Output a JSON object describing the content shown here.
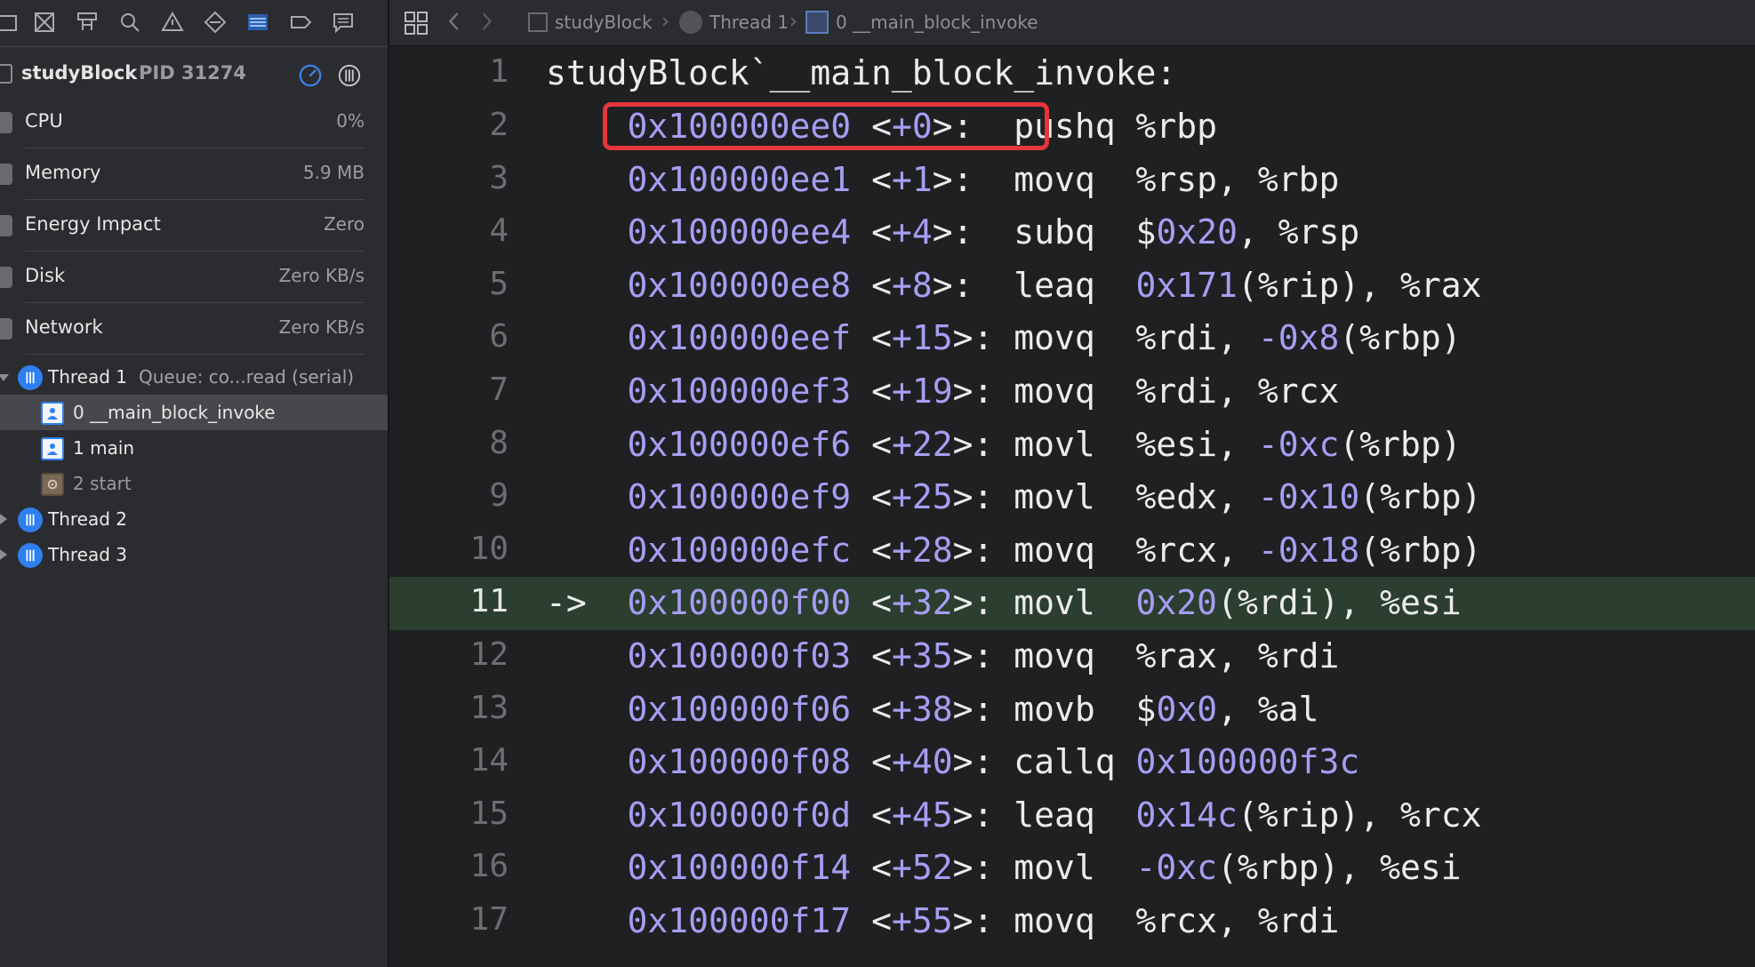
{
  "navigator": {
    "toolbar_icons": [
      "folder-icon",
      "source-control-icon",
      "symbol-icon",
      "find-icon",
      "issue-icon",
      "test-icon",
      "debug-icon",
      "breakpoint-icon",
      "report-icon"
    ],
    "process": {
      "name": "studyBlock",
      "pid": "PID 31274"
    },
    "gauges": [
      {
        "label": "CPU",
        "value": "0%"
      },
      {
        "label": "Memory",
        "value": "5.9 MB"
      },
      {
        "label": "Energy Impact",
        "value": "Zero"
      },
      {
        "label": "Disk",
        "value": "Zero KB/s"
      },
      {
        "label": "Network",
        "value": "Zero KB/s"
      }
    ],
    "threads": [
      {
        "label": "Thread 1",
        "queue": "Queue: co...read (serial)",
        "expanded": true,
        "frames": [
          {
            "label": "0 __main_block_invoke",
            "selected": true
          },
          {
            "label": "1 main",
            "selected": false
          },
          {
            "label": "2 start",
            "selected": false
          }
        ]
      },
      {
        "label": "Thread 2",
        "expanded": false
      },
      {
        "label": "Thread 3",
        "expanded": false
      }
    ]
  },
  "jumpbar": {
    "items": [
      "studyBlock",
      "Thread 1",
      "0 __main_block_invoke"
    ]
  },
  "editor": {
    "header": "studyBlock`__main_block_invoke:",
    "lines": [
      {
        "n": "2",
        "arrow": "",
        "addr": "0x100000ee0",
        "off": "<+0>:",
        "op": "pushq",
        "args": "%rbp"
      },
      {
        "n": "3",
        "arrow": "",
        "addr": "0x100000ee1",
        "off": "<+1>:",
        "op": "movq",
        "args": "%rsp, %rbp"
      },
      {
        "n": "4",
        "arrow": "",
        "addr": "0x100000ee4",
        "off": "<+4>:",
        "op": "subq",
        "args": "$0x20, %rsp"
      },
      {
        "n": "5",
        "arrow": "",
        "addr": "0x100000ee8",
        "off": "<+8>:",
        "op": "leaq",
        "args": "0x171(%rip), %rax"
      },
      {
        "n": "6",
        "arrow": "",
        "addr": "0x100000eef",
        "off": "<+15>:",
        "op": "movq",
        "args": "%rdi, -0x8(%rbp)"
      },
      {
        "n": "7",
        "arrow": "",
        "addr": "0x100000ef3",
        "off": "<+19>:",
        "op": "movq",
        "args": "%rdi, %rcx"
      },
      {
        "n": "8",
        "arrow": "",
        "addr": "0x100000ef6",
        "off": "<+22>:",
        "op": "movl",
        "args": "%esi, -0xc(%rbp)"
      },
      {
        "n": "9",
        "arrow": "",
        "addr": "0x100000ef9",
        "off": "<+25>:",
        "op": "movl",
        "args": "%edx, -0x10(%rbp)"
      },
      {
        "n": "10",
        "arrow": "",
        "addr": "0x100000efc",
        "off": "<+28>:",
        "op": "movq",
        "args": "%rcx, -0x18(%rbp)"
      },
      {
        "n": "11",
        "arrow": "->",
        "addr": "0x100000f00",
        "off": "<+32>:",
        "op": "movl",
        "args": "0x20(%rdi), %esi"
      },
      {
        "n": "12",
        "arrow": "",
        "addr": "0x100000f03",
        "off": "<+35>:",
        "op": "movq",
        "args": "%rax, %rdi"
      },
      {
        "n": "13",
        "arrow": "",
        "addr": "0x100000f06",
        "off": "<+38>:",
        "op": "movb",
        "args": "$0x0, %al"
      },
      {
        "n": "14",
        "arrow": "",
        "addr": "0x100000f08",
        "off": "<+40>:",
        "op": "callq",
        "args": "0x100000f3c"
      },
      {
        "n": "15",
        "arrow": "",
        "addr": "0x100000f0d",
        "off": "<+45>:",
        "op": "leaq",
        "args": "0x14c(%rip), %rcx"
      },
      {
        "n": "16",
        "arrow": "",
        "addr": "0x100000f14",
        "off": "<+52>:",
        "op": "movl",
        "args": "-0xc(%rbp), %esi"
      },
      {
        "n": "17",
        "arrow": "",
        "addr": "0x100000f17",
        "off": "<+55>:",
        "op": "movq",
        "args": "%rcx, %rdi"
      }
    ]
  },
  "colors": {
    "background": "#1f2022",
    "sidebar": "#2b2c2f",
    "address": "#a79df2",
    "current_line": "#2b3e2f",
    "highlight_box": "#e5353d",
    "thread_icon": "#2f7ff0"
  }
}
